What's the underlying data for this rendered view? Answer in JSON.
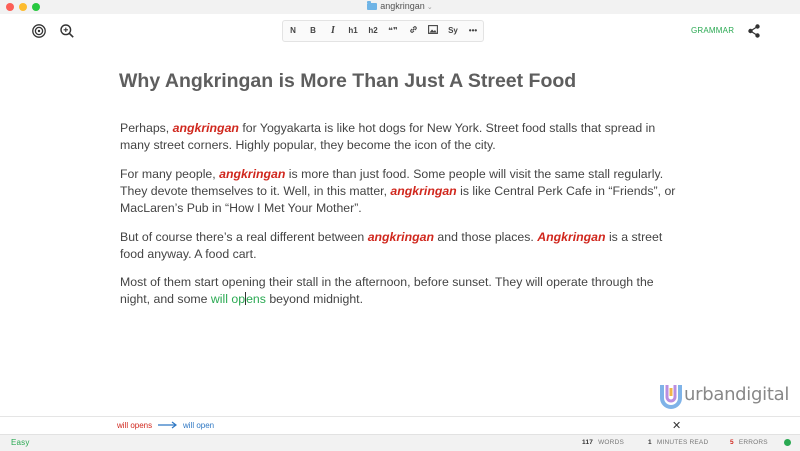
{
  "window": {
    "title": "angkringan"
  },
  "toolbar": {
    "format_buttons": [
      "N",
      "B",
      "I",
      "h1",
      "h2",
      "❝❞",
      "🔗",
      "🖼",
      "Sy",
      "•••"
    ],
    "grammar_label": "GRAMMAR"
  },
  "document": {
    "heading": "Why Angkringan is More Than Just A Street Food",
    "p1": {
      "a": "Perhaps, ",
      "kw1": "angkringan",
      "b": " for Yogyakarta is like hot dogs for New York. Street food stalls that spread in many street corners. Highly popular, they become the icon of the city."
    },
    "p2": {
      "a": "For many people, ",
      "kw1": "angkringan",
      "b": " is more than just food. Some people will visit the same stall regularly. They devote themselves to it. Well, in this matter, ",
      "kw2": "angkringan",
      "c": " is like Central Perk Cafe in “Friends”, or MacLaren’s Pub in “How I Met Your Mother”."
    },
    "p3": {
      "a": "But of course there’s a real different between ",
      "kw1": "angkringan",
      "b": " and those places. ",
      "kw2": "Angkringan",
      "c": " is a street food anyway. A food cart."
    },
    "p4": {
      "a": "Most of them start opening their stall in the afternoon, before sunset. They will operate through the night, and some ",
      "hl_before": "will op",
      "hl_after": "ens",
      "b": " beyond midnight."
    }
  },
  "suggestion": {
    "wrong": "will opens",
    "right": "will open"
  },
  "status": {
    "readability": "Easy",
    "words_count": "117",
    "words_label": "WORDS",
    "minutes_count": "1",
    "minutes_label": "MINUTES READ",
    "errors_count": "5",
    "errors_label": "ERRORS",
    "indicator_color": "#2aa952"
  },
  "watermark": {
    "text": "urbandigital"
  },
  "colors": {
    "keyword": "#d0271d",
    "suggestion_green": "#2aa952",
    "suggestion_blue": "#2f78c4"
  }
}
